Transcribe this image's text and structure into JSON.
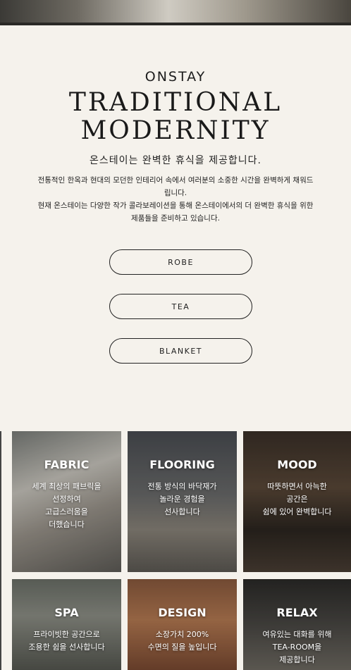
{
  "brand": "ONSTAY",
  "headline": {
    "line1": "TRADITIONAL",
    "line2": "MODERNITY"
  },
  "subtitle": "온스테이는 완벽한 휴식을 제공합니다.",
  "description": {
    "line1": "전통적인 한옥과 현대의 모던한 인테리어 속에서 여러분의 소중한 시간을 완벽하게 채워드립니다.",
    "line2": "현재 온스테이는 다양한 작가 콜라보레이션을 통해 온스테이에서의 더 완벽한 휴식을 위한 제품들을 준비하고 있습니다."
  },
  "buttons": [
    "ROBE",
    "TEA",
    "BLANKET"
  ],
  "tiles": [
    {
      "title": "FABRIC",
      "text": "세계 최상의 패브릭을\n선정하여\n고급스러움을\n더했습니다"
    },
    {
      "title": "FLOORING",
      "text": "전통 방식의 바닥재가\n놀라운 경험을\n선사합니다"
    },
    {
      "title": "MOOD",
      "text": "따뜻하면서 아늑한\n공간은\n쉼에 있어 완벽합니다"
    },
    {
      "title": "SPA",
      "text": "프라이빗한 공간으로\n조용한 쉼을 선사합니다"
    },
    {
      "title": "DESIGN",
      "text": "소장가치 200%\n수면의 질을 높입니다"
    },
    {
      "title": "RELAX",
      "text": "여유있는 대화를 위해\nTEA-ROOM을\n제공합니다"
    }
  ]
}
